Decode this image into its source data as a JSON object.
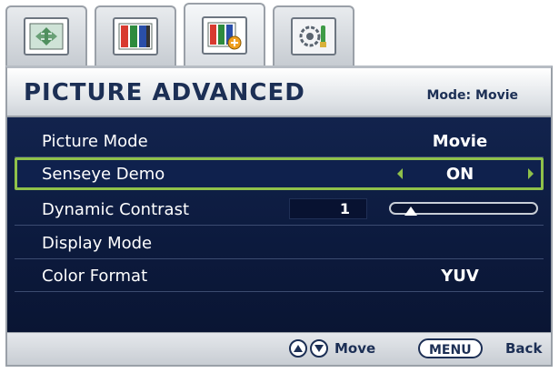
{
  "header": {
    "title": "PICTURE ADVANCED",
    "mode_label": "Mode: Movie"
  },
  "tabs": [
    {
      "icon": "display-settings-icon",
      "active": false
    },
    {
      "icon": "picture-icon",
      "active": false
    },
    {
      "icon": "picture-advanced-icon",
      "active": true
    },
    {
      "icon": "system-settings-icon",
      "active": false
    }
  ],
  "menu": {
    "rows": [
      {
        "label": "Picture Mode",
        "value": "Movie"
      },
      {
        "label": "Senseye Demo",
        "value": "ON"
      },
      {
        "label": "Dynamic Contrast",
        "value": "1",
        "level_fraction": 0.05
      },
      {
        "label": "Display Mode",
        "value": ""
      },
      {
        "label": "Color Format",
        "value": "YUV"
      }
    ]
  },
  "footer": {
    "move_label": "Move",
    "menu_button_label": "MENU",
    "back_label": "Back"
  },
  "colors": {
    "menu_background": "#0c1a3d",
    "selection_border": "#8fc14a",
    "text_dark": "#1c2f55"
  }
}
